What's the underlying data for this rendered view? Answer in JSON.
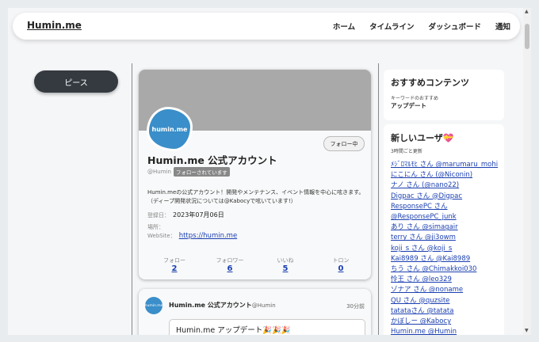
{
  "nav": {
    "brand": "Humin.me",
    "links": [
      "ホーム",
      "タイムライン",
      "ダッシュボード",
      "通知"
    ]
  },
  "left": {
    "peace_button": "ピース"
  },
  "profile": {
    "avatar_text": "humin.me",
    "follow_status": "フォロー中",
    "name": "Humin.me 公式アカウント",
    "handle": "@Humin",
    "followed_badge": "フォローされています",
    "bio": "Humin.meの公式アカウント！開発やメンテナンス、イベント情報を中心に呟きます。（ディープ開発状況については@Kabocyで呟いています!）",
    "registered_label": "登録日：",
    "registered_value": "2023年07月06日",
    "location_label": "場所：",
    "website_label": "WebSite：",
    "website_value": "https://humin.me",
    "stats": [
      {
        "label": "フォロー",
        "value": "2"
      },
      {
        "label": "フォロワー",
        "value": "6"
      },
      {
        "label": "いいね",
        "value": "5"
      },
      {
        "label": "トロン",
        "value": "0"
      }
    ]
  },
  "post": {
    "avatar_text": "humin.me",
    "author": "Humin.me 公式アカウント",
    "handle": "@Humin",
    "time": "30分前",
    "body": "Humin.me アップデート🎉🎉🎉"
  },
  "recommend": {
    "title": "おすすめコンテンツ",
    "keyword_label": "キーワードのおすすめ",
    "keyword": "アップデート"
  },
  "new_users": {
    "title": "新しいユーザ💝",
    "subtitle": "3時間ごと更新",
    "users": [
      "ﾒｼﾞﾛﾏﾙﾓﾋ さん @marumaru_mohi",
      "にこにん さん (@Niconin)",
      "ナノ さん (@nano22)",
      "Digpac さん @Digpac",
      "ResponsePC さん",
      "@ResponsePC_junk",
      "あり さん @simagair",
      "terry さん @ji3owm",
      "koji_s さん @koji_s",
      "Kai8989 さん @Kai8989",
      "ちう さん @Chimakkoi030",
      "怜王 さん @leo329",
      "ゾナア さん @noname",
      "QU さん @quzsite",
      "tatataさん @tatata",
      "かぼしー @Kabocy",
      "Humin.me @Humin"
    ]
  }
}
